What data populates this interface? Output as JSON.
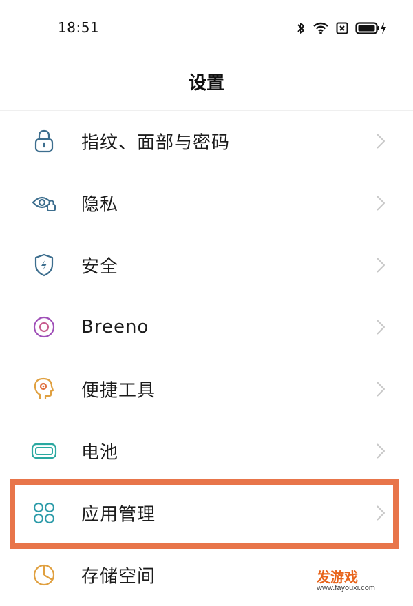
{
  "status_bar": {
    "time": "18:51"
  },
  "header": {
    "title": "设置"
  },
  "settings": {
    "items": [
      {
        "label": "指纹、面部与密码",
        "icon": "lock-icon"
      },
      {
        "label": "隐私",
        "icon": "privacy-eye-icon"
      },
      {
        "label": "安全",
        "icon": "shield-icon"
      },
      {
        "label": "Breeno",
        "icon": "breeno-icon"
      },
      {
        "label": "便捷工具",
        "icon": "convenience-tools-icon"
      },
      {
        "label": "电池",
        "icon": "battery-icon"
      },
      {
        "label": "应用管理",
        "icon": "apps-icon"
      },
      {
        "label": "存储空间",
        "icon": "storage-pie-icon"
      }
    ],
    "highlighted_item": "应用管理"
  },
  "watermark": {
    "title": "发游戏",
    "url": "www.fayouxi.com"
  },
  "colors": {
    "highlight": "#e8754a",
    "icon_blue": "#3d6e8e",
    "icon_purple": "#a050b8",
    "icon_orange": "#e0a040",
    "icon_teal": "#2aa8a0",
    "chevron": "#c8c8c8"
  }
}
